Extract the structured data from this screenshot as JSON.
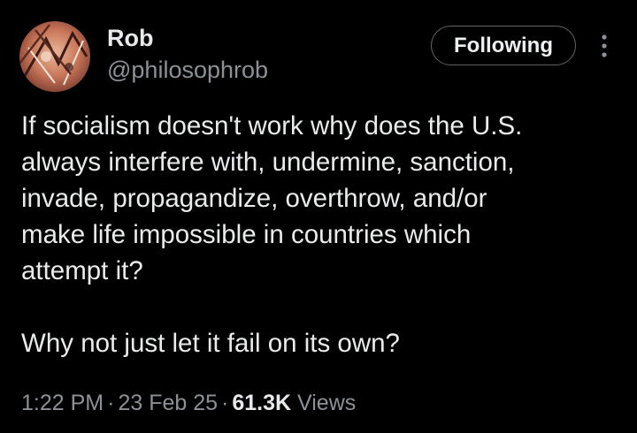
{
  "author": {
    "display_name": "Rob",
    "handle": "@philosophrob"
  },
  "follow_button": {
    "label": "Following"
  },
  "tweet": {
    "lines": [
      "If socialism doesn't work why does the U.S.",
      "always interfere with, undermine, sanction,",
      "invade, propagandize, overthrow, and/or",
      "make life impossible in countries which",
      "attempt it?"
    ],
    "paragraph2": "Why not just let it fail on its own?"
  },
  "meta": {
    "time": "1:22 PM",
    "separator": "·",
    "date": "23 Feb 25",
    "views_count": "61.3K",
    "views_label": "Views"
  },
  "icons": {
    "more": "more-vertical-icon"
  },
  "colors": {
    "background": "#000000",
    "text_primary": "#e7e9ea",
    "text_secondary": "#8b9196",
    "button_border": "#5c6166"
  }
}
